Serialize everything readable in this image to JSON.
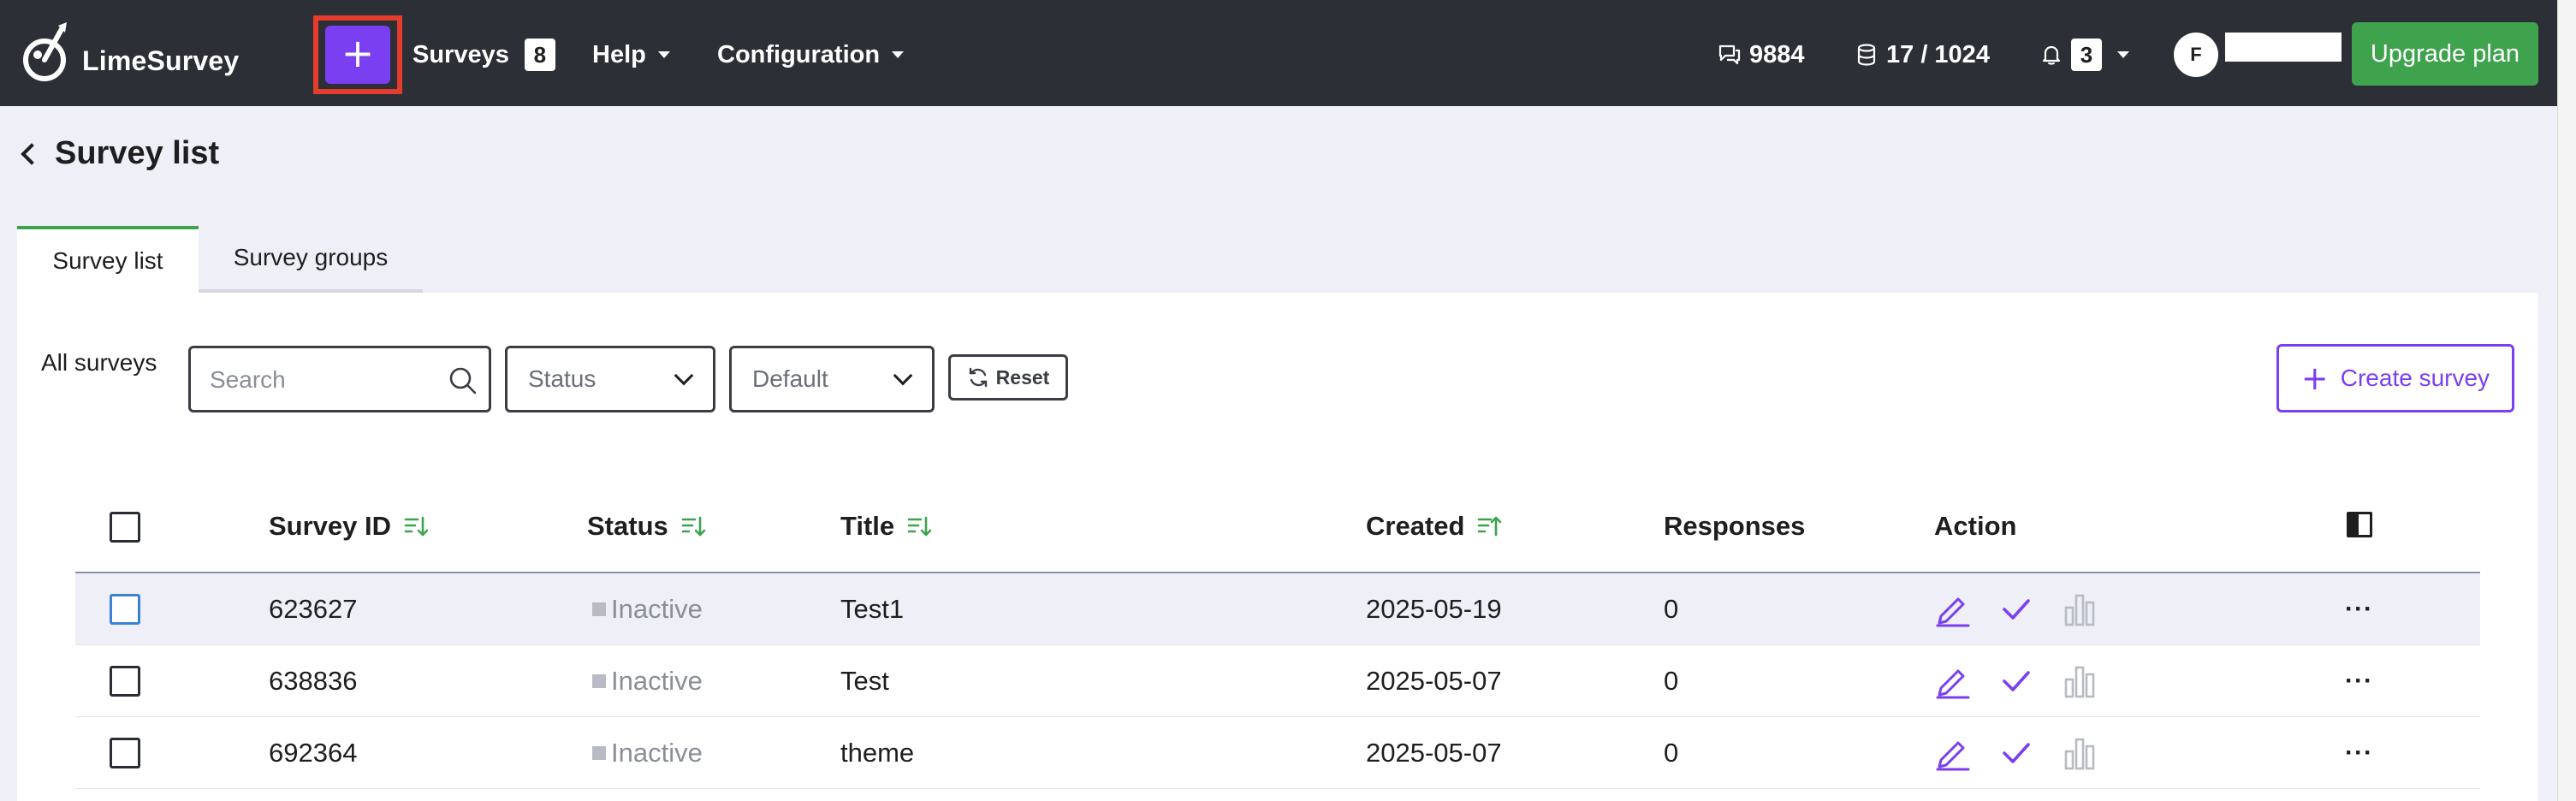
{
  "nav": {
    "brand": "LimeSurvey",
    "surveys_label": "Surveys",
    "surveys_count": "8",
    "help_label": "Help",
    "configuration_label": "Configuration",
    "responses_stat": "9884",
    "storage_stat": "17 / 1024",
    "notifications_count": "3",
    "avatar_initial": "F",
    "upgrade_label": "Upgrade plan",
    "accent_color": "#7b3ff2",
    "upgrade_color": "#3fa34d"
  },
  "page": {
    "title": "Survey list"
  },
  "tabs": [
    {
      "label": "Survey list",
      "active": true
    },
    {
      "label": "Survey groups",
      "active": false
    }
  ],
  "filters": {
    "label": "All surveys",
    "search_placeholder": "Search",
    "status_value": "Status",
    "sort_value": "Default",
    "reset_label": "Reset",
    "create_label": "Create survey"
  },
  "table": {
    "columns": [
      "Survey ID",
      "Status",
      "Title",
      "Created",
      "Responses",
      "Action"
    ],
    "rows": [
      {
        "id": "623627",
        "status": "Inactive",
        "title": "Test1",
        "created": "2025-05-19",
        "responses": "0"
      },
      {
        "id": "638836",
        "status": "Inactive",
        "title": "Test",
        "created": "2025-05-07",
        "responses": "0"
      },
      {
        "id": "692364",
        "status": "Inactive",
        "title": "theme",
        "created": "2025-05-07",
        "responses": "0"
      }
    ],
    "more_label": "···"
  }
}
